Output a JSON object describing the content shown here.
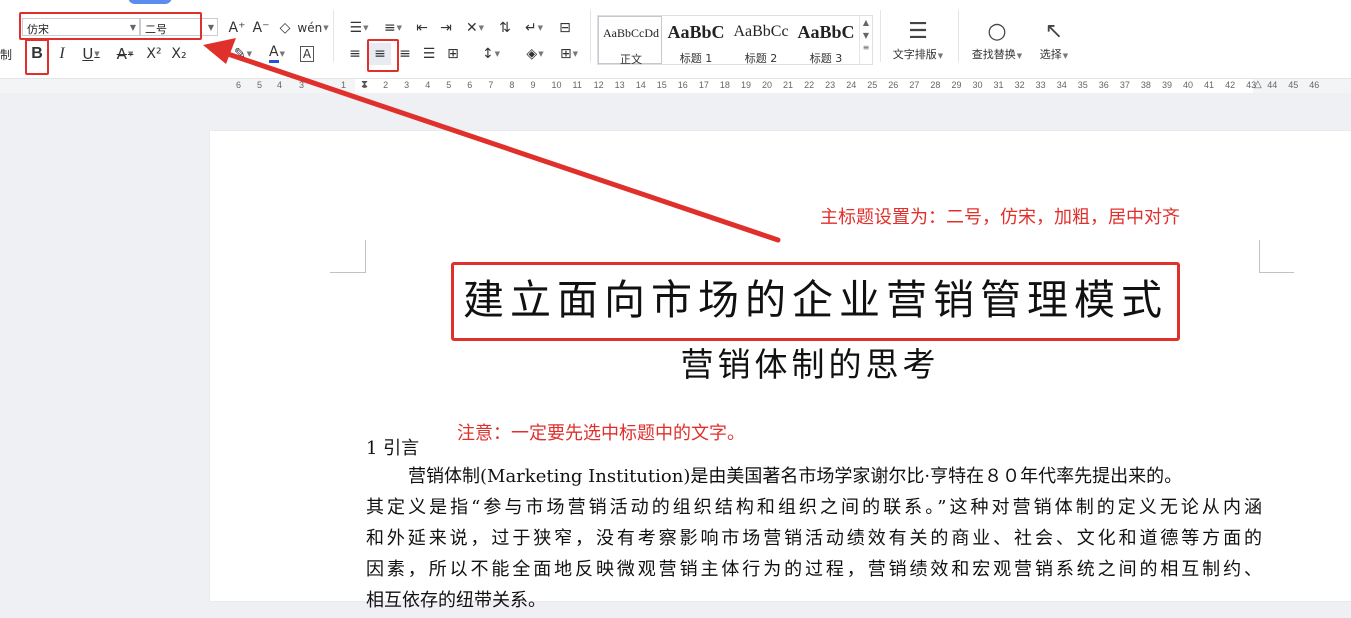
{
  "toolbar": {
    "font_family": "仿宋",
    "font_size": "二号",
    "left_clip_label": "制",
    "bold_label": "B",
    "italic_label": "I",
    "underline_label": "U",
    "superscript_label": "X²",
    "subscript_label": "X₂",
    "grow_font_label": "A⁺",
    "shrink_font_label": "A⁻",
    "pinyin_label": "wén",
    "font_color_label": "A",
    "char_border_label": "A",
    "styles": [
      {
        "preview": "AaBbCcDd",
        "name": "正文"
      },
      {
        "preview": "AaBbC",
        "name": "标题 1"
      },
      {
        "preview": "AaBbCc",
        "name": "标题 2"
      },
      {
        "preview": "AaBbC",
        "name": "标题 3"
      }
    ],
    "text_layout_label": "文字排版",
    "find_replace_label": "查找替换",
    "select_label": "选择"
  },
  "ruler": {
    "numbers": [
      "6",
      "5",
      "4",
      "3",
      "1",
      "1",
      "2",
      "3",
      "4",
      "5",
      "6",
      "7",
      "8",
      "9",
      "10",
      "11",
      "12",
      "13",
      "14",
      "15",
      "16",
      "17",
      "18",
      "19",
      "20",
      "21",
      "22",
      "23",
      "24",
      "25",
      "26",
      "27",
      "28",
      "29",
      "30",
      "31",
      "32",
      "33",
      "34",
      "35",
      "36",
      "37",
      "38",
      "39",
      "40",
      "41",
      "42",
      "43",
      "44",
      "45",
      "46"
    ]
  },
  "annotations": {
    "title_note": "主标题设置为：二号，仿宋，加粗，居中对齐",
    "selection_note": "注意：一定要先选中标题中的文字。"
  },
  "document": {
    "main_title": "建立面向市场的企业营销管理模式",
    "subtitle": "营销体制的思考",
    "section_heading": "1 引言",
    "paragraph_lines": [
      "营销体制(Marketing Institution)是由美国著名市场学家谢尔比·亨特在８０年代率先提出来的。",
      "其定义是指“参与市场营销活动的组织结构和组织之间的联系。”这种对营销体制的定义无论从内涵",
      "和外延来说，过于狭窄，没有考察影响市场营销活动绩效有关的商业、社会、文化和道德等方面的",
      "因素，所以不能全面地反映微观营销主体行为的过程，营销绩效和宏观营销系统之间的相互制约、",
      "相互依存的纽带关系。"
    ]
  },
  "colors": {
    "annotation_red": "#e0302c",
    "accent_blue": "#5b8def"
  }
}
